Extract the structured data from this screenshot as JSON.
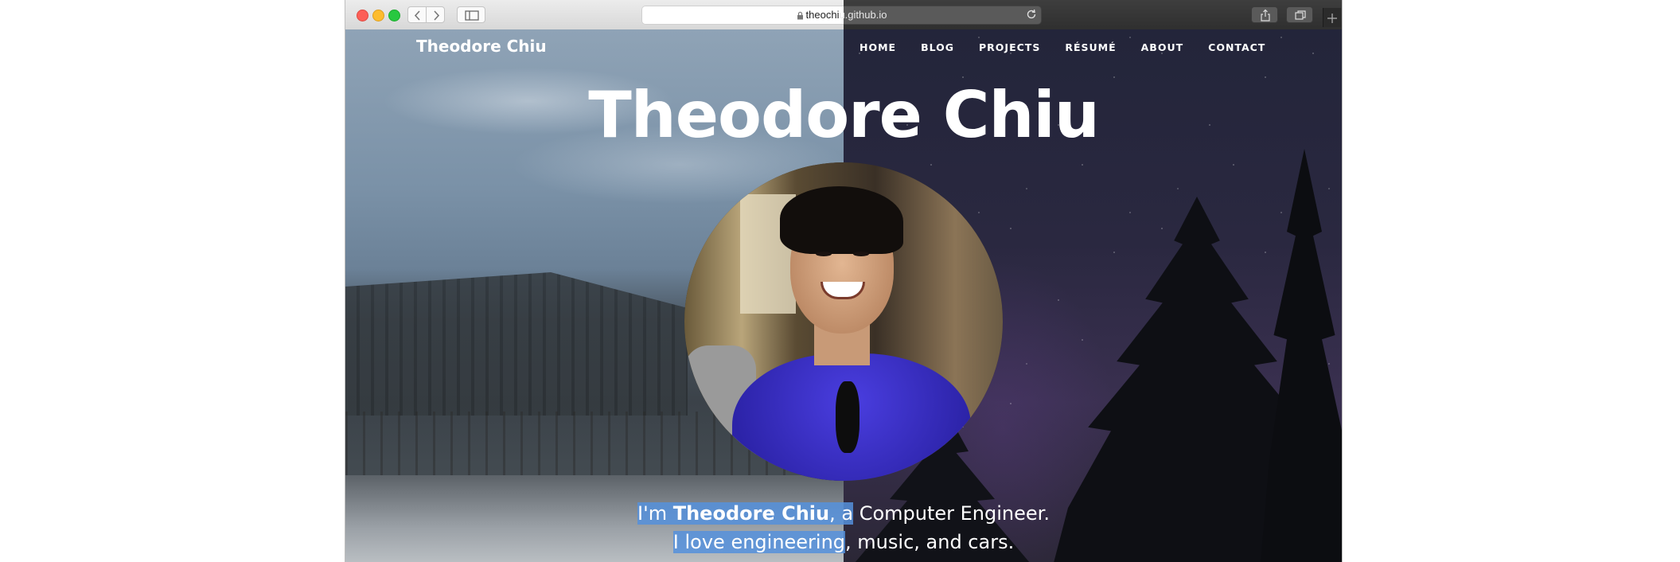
{
  "browser": {
    "url": "theochiu.github.io",
    "url_part_light_bg": "theochi",
    "url_part_dark_bg": "u.github.io"
  },
  "site": {
    "brand": "Theodore Chiu",
    "nav": [
      "HOME",
      "BLOG",
      "PROJECTS",
      "RÉSUMÉ",
      "ABOUT",
      "CONTACT"
    ],
    "hero_title": "Theodore Chiu",
    "tagline": {
      "line1_a_selected": "I'm ",
      "line1_name_selected": "Theodore Chiu",
      "line1_b_selected": ", a",
      "line1_rest": " Computer Engineer.",
      "line2_selected": "I love engineering",
      "line2_rest": ", music, and cars."
    }
  },
  "colors": {
    "selection": "#5591dc",
    "text": "#ffffff",
    "traffic_red": "#fc5f57",
    "traffic_yellow": "#fdbc2e",
    "traffic_green": "#28c840"
  },
  "icons": [
    "close-icon",
    "minimize-icon",
    "zoom-icon",
    "chevron-left-icon",
    "chevron-right-icon",
    "sidebar-icon",
    "lock-icon",
    "reload-icon",
    "share-icon",
    "tabs-icon",
    "plus-icon"
  ]
}
